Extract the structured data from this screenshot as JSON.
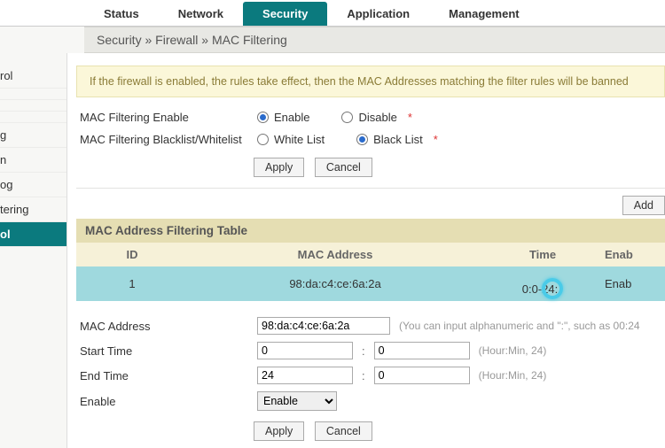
{
  "topnav": {
    "tabs": [
      {
        "label": "Status",
        "active": false
      },
      {
        "label": "Network",
        "active": false
      },
      {
        "label": "Security",
        "active": true
      },
      {
        "label": "Application",
        "active": false
      },
      {
        "label": "Management",
        "active": false
      }
    ]
  },
  "breadcrumb": {
    "segments": [
      "Security",
      "Firewall",
      "MAC Filtering"
    ]
  },
  "sidebar": {
    "items": [
      {
        "label": "rol",
        "active": false
      },
      {
        "label": "",
        "active": false
      },
      {
        "label": "",
        "active": false
      },
      {
        "label": "",
        "active": false
      },
      {
        "label": "g",
        "active": false
      },
      {
        "label": "n",
        "active": false
      },
      {
        "label": "og",
        "active": false
      },
      {
        "label": "tering",
        "active": false
      },
      {
        "label": "ol",
        "active": true
      }
    ]
  },
  "notice": "If the firewall is enabled, the rules take effect, then the MAC Addresses matching the filter rules will be banned",
  "form1": {
    "mac_enable_label": "MAC Filtering Enable",
    "mac_enable_options": [
      "Enable",
      "Disable"
    ],
    "mac_enable_selected": "Enable",
    "list_label": "MAC Filtering Blacklist/Whitelist",
    "list_options": [
      "White List",
      "Black List"
    ],
    "list_selected": "Black List",
    "apply": "Apply",
    "cancel": "Cancel"
  },
  "add_button": "Add",
  "table": {
    "title": "MAC Address Filtering Table",
    "headers": {
      "id": "ID",
      "mac": "MAC Address",
      "time": "Time",
      "enable": "Enab"
    },
    "rows": [
      {
        "id": "1",
        "mac": "98:da:c4:ce:6a:2a",
        "time": "0:0-24:",
        "enable": "Enab"
      }
    ]
  },
  "edit": {
    "mac_label": "MAC Address",
    "mac_value": "98:da:c4:ce:6a:2a",
    "mac_hint": "(You can input alphanumeric and \":\", such as 00:24",
    "start_label": "Start Time",
    "start_hour": "0",
    "start_min": "0",
    "start_hint": "(Hour:Min, 24)",
    "end_label": "End Time",
    "end_hour": "24",
    "end_min": "0",
    "end_hint": "(Hour:Min, 24)",
    "enable_label": "Enable",
    "enable_value": "Enable",
    "apply": "Apply",
    "cancel": "Cancel"
  }
}
